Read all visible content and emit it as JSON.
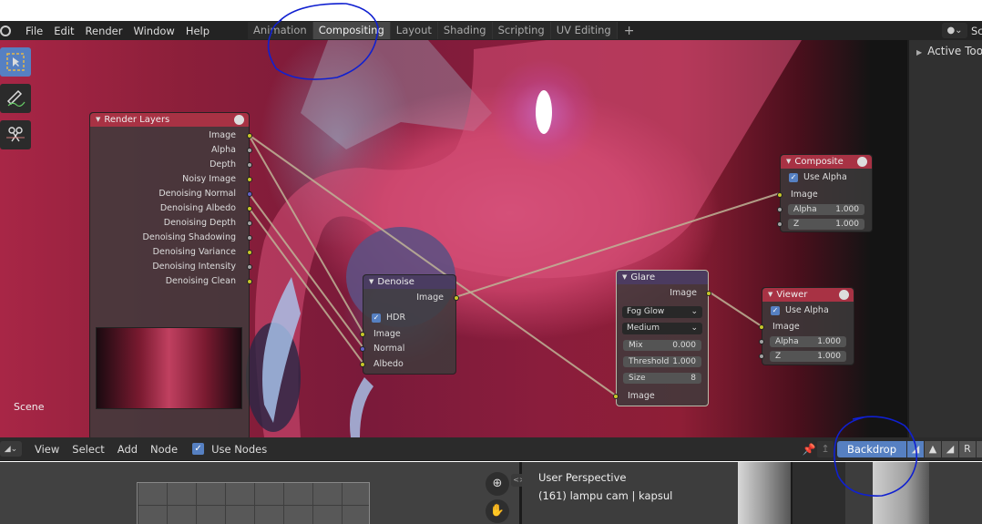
{
  "menubar": {
    "items": [
      "File",
      "Edit",
      "Render",
      "Window",
      "Help"
    ],
    "workspaces": [
      "Animation",
      "Compositing",
      "Layout",
      "Shading",
      "Scripting",
      "UV Editing"
    ],
    "active_workspace": "Compositing",
    "add_tab": "+",
    "scene_text": "Sc"
  },
  "sidebar": {
    "active_tool_label": "Active Tool"
  },
  "toolbox": [
    "select-box",
    "annotate",
    "cut-links"
  ],
  "nodes": {
    "render_layers": {
      "title": "Render Layers",
      "outputs": [
        {
          "label": "Image",
          "type": "color"
        },
        {
          "label": "Alpha",
          "type": "value"
        },
        {
          "label": "Depth",
          "type": "value"
        },
        {
          "label": "Noisy Image",
          "type": "color"
        },
        {
          "label": "Denoising Normal",
          "type": "vector"
        },
        {
          "label": "Denoising Albedo",
          "type": "color"
        },
        {
          "label": "Denoising Depth",
          "type": "value"
        },
        {
          "label": "Denoising Shadowing",
          "type": "value"
        },
        {
          "label": "Denoising Variance",
          "type": "color"
        },
        {
          "label": "Denoising Intensity",
          "type": "value"
        },
        {
          "label": "Denoising Clean",
          "type": "color"
        }
      ],
      "scene": "Scene"
    },
    "denoise": {
      "title": "Denoise",
      "output": "Image",
      "hdr_label": "HDR",
      "hdr_checked": true,
      "inputs": [
        "Image",
        "Normal",
        "Albedo"
      ]
    },
    "glare": {
      "title": "Glare",
      "output": "Image",
      "glare_type": "Fog Glow",
      "quality": "Medium",
      "mix_label": "Mix",
      "mix_value": "0.000",
      "threshold_label": "Threshold",
      "threshold_value": "1.000",
      "size_label": "Size",
      "size_value": "8",
      "input": "Image"
    },
    "composite": {
      "title": "Composite",
      "use_alpha_label": "Use Alpha",
      "use_alpha": true,
      "input": "Image",
      "alpha_label": "Alpha",
      "alpha_value": "1.000",
      "z_label": "Z",
      "z_value": "1.000"
    },
    "viewer": {
      "title": "Viewer",
      "use_alpha_label": "Use Alpha",
      "use_alpha": true,
      "input": "Image",
      "alpha_label": "Alpha",
      "alpha_value": "1.000",
      "z_label": "Z",
      "z_value": "1.000"
    }
  },
  "node_header": {
    "menus": [
      "View",
      "Select",
      "Add",
      "Node"
    ],
    "use_nodes_label": "Use Nodes",
    "use_nodes": true,
    "backdrop_label": "Backdrop",
    "channel_r": "R"
  },
  "viewport": {
    "view_name": "User Perspective",
    "object_info": "(161) lampu cam | kapsul"
  },
  "colors": {
    "accent": "#5680c2",
    "node_header_output": "#a83244",
    "socket_color": "#c7c729",
    "socket_value": "#a1a1a1",
    "socket_vector": "#6363c7",
    "annotation": "#1020d0"
  }
}
